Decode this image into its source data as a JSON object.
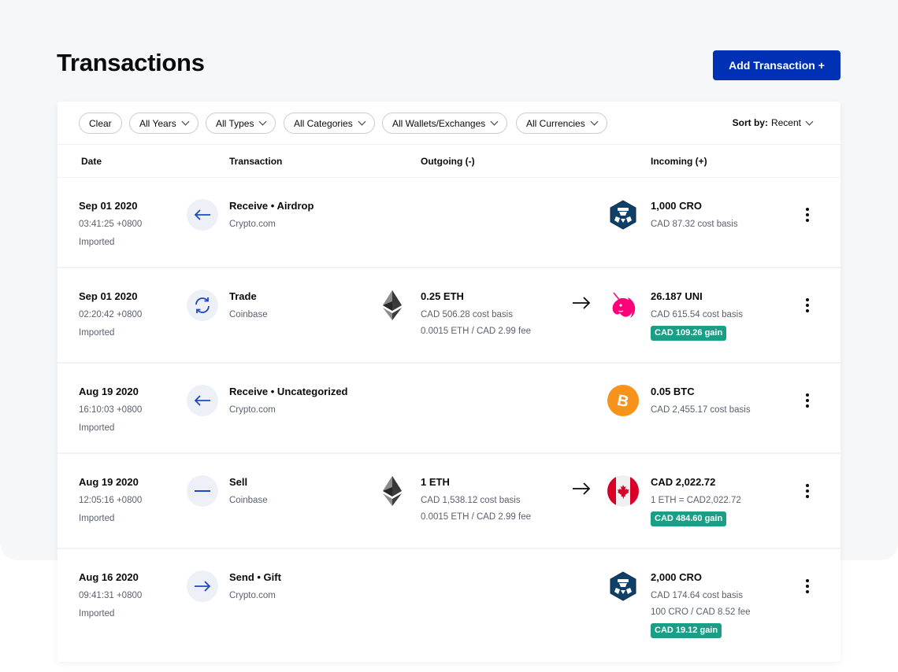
{
  "header": {
    "title": "Transactions",
    "add_button_label": "Add Transaction +"
  },
  "filters": {
    "clear_label": "Clear",
    "dropdowns": [
      "All Years",
      "All Types",
      "All Categories",
      "All Wallets/Exchanges",
      "All Currencies"
    ],
    "sort_label": "Sort by:",
    "sort_value": "Recent"
  },
  "table": {
    "columns": [
      "Date",
      "Transaction",
      "Outgoing (-)",
      "Incoming (+)"
    ],
    "rows": [
      {
        "date": "Sep 01 2020",
        "time": "03:41:25 +0800",
        "source": "Imported",
        "type_icon": "arrow-left-icon",
        "title": "Receive • Airdrop",
        "platform": "Crypto.com",
        "incoming": {
          "coin_icon": "cro-icon",
          "amount": "1,000 CRO",
          "line1": "CAD 87.32 cost basis"
        }
      },
      {
        "date": "Sep 01 2020",
        "time": "02:20:42 +0800",
        "source": "Imported",
        "type_icon": "swap-icon",
        "title": "Trade",
        "platform": "Coinbase",
        "outgoing": {
          "coin_icon": "eth-icon",
          "amount": "0.25 ETH",
          "line1": "CAD 506.28 cost basis",
          "line2": "0.0015 ETH / CAD 2.99 fee"
        },
        "incoming": {
          "coin_icon": "uni-icon",
          "amount": "26.187 UNI",
          "line1": "CAD 615.54 cost basis",
          "gain": "CAD 109.26 gain"
        }
      },
      {
        "date": "Aug 19 2020",
        "time": "16:10:03 +0800",
        "source": "Imported",
        "type_icon": "arrow-left-icon",
        "title": "Receive • Uncategorized",
        "platform": "Crypto.com",
        "incoming": {
          "coin_icon": "btc-icon",
          "amount": "0.05 BTC",
          "line1": "CAD 2,455.17 cost basis"
        }
      },
      {
        "date": "Aug 19 2020",
        "time": "12:05:16 +0800",
        "source": "Imported",
        "type_icon": "minus-icon",
        "title": "Sell",
        "platform": "Coinbase",
        "outgoing": {
          "coin_icon": "eth-icon",
          "amount": "1 ETH",
          "line1": "CAD 1,538.12 cost basis",
          "line2": "0.0015 ETH / CAD 2.99 fee"
        },
        "incoming": {
          "coin_icon": "cad-flag-icon",
          "amount": "CAD 2,022.72",
          "line1": "1 ETH = CAD2,022.72",
          "gain": "CAD 484.60 gain"
        }
      },
      {
        "date": "Aug 16 2020",
        "time": "09:41:31 +0800",
        "source": "Imported",
        "type_icon": "arrow-right-icon",
        "title": "Send • Gift",
        "platform": "Crypto.com",
        "incoming": {
          "coin_icon": "cro-icon",
          "amount": "2,000 CRO",
          "line1": "CAD 174.64 cost basis",
          "line2": "100 CRO / CAD 8.52 fee",
          "gain": "CAD 19.12 gain"
        }
      }
    ]
  },
  "colors": {
    "accent": "#0030b3",
    "icon_blue": "#1f48c6",
    "gain_badge": "#1a9e86",
    "background": "#f6f7f9",
    "muted_text": "#5b616e"
  }
}
